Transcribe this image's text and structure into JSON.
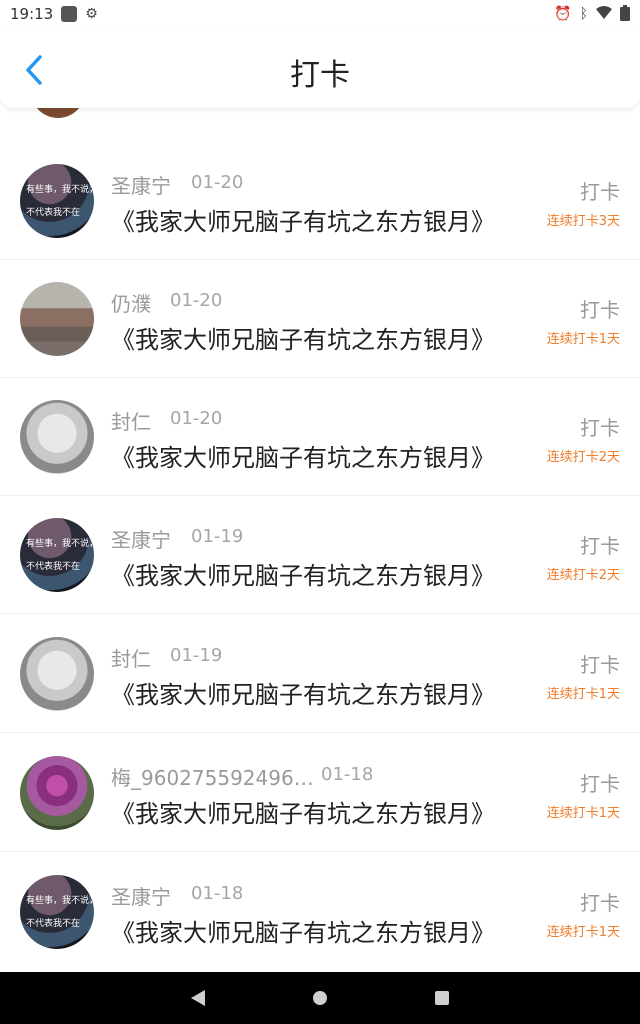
{
  "status_bar": {
    "time": "19:13"
  },
  "header": {
    "title": "打卡"
  },
  "colors": {
    "accent": "#f07c2a",
    "back": "#2196f3"
  },
  "list": [
    {
      "name": "圣康宁",
      "date": "01-20",
      "book": "《我家大师兄脑子有坑之东方银月》",
      "action": "打卡",
      "streak": "连续打卡3天",
      "avatar": "dark-water-avatar",
      "avatar_text_top": "有些事，我不说，",
      "avatar_text_bottom": "不代表我不在"
    },
    {
      "name": "仍濮",
      "date": "01-20",
      "book": "《我家大师兄脑子有坑之东方银月》",
      "action": "打卡",
      "streak": "连续打卡1天",
      "avatar": "street-avatar"
    },
    {
      "name": "封仁",
      "date": "01-20",
      "book": "《我家大师兄脑子有坑之东方银月》",
      "action": "打卡",
      "streak": "连续打卡2天",
      "avatar": "grayscale-portrait-avatar"
    },
    {
      "name": "圣康宁",
      "date": "01-19",
      "book": "《我家大师兄脑子有坑之东方银月》",
      "action": "打卡",
      "streak": "连续打卡2天",
      "avatar": "dark-water-avatar",
      "avatar_text_top": "有些事，我不说，",
      "avatar_text_bottom": "不代表我不在"
    },
    {
      "name": "封仁",
      "date": "01-19",
      "book": "《我家大师兄脑子有坑之东方银月》",
      "action": "打卡",
      "streak": "连续打卡1天",
      "avatar": "grayscale-portrait-avatar"
    },
    {
      "name": "梅_960275592496…",
      "date": "01-18",
      "book": "《我家大师兄脑子有坑之东方银月》",
      "action": "打卡",
      "streak": "连续打卡1天",
      "avatar": "flower-avatar"
    },
    {
      "name": "圣康宁",
      "date": "01-18",
      "book": "《我家大师兄脑子有坑之东方银月》",
      "action": "打卡",
      "streak": "连续打卡1天",
      "avatar": "dark-water-avatar",
      "avatar_text_top": "有些事，我不说，",
      "avatar_text_bottom": "不代表我不在"
    }
  ]
}
